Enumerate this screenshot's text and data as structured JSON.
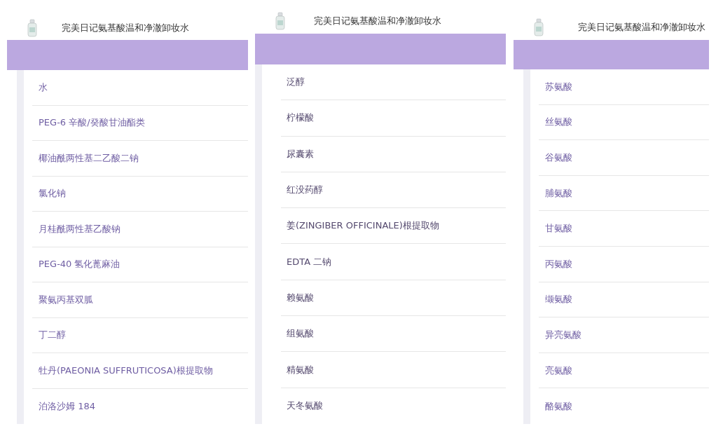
{
  "panels": [
    {
      "title": "完美日记氨基酸温和净澈卸妆水",
      "ingredients": [
        "水",
        "PEG-6 辛酸/癸酸甘油酯类",
        "椰油酰两性基二乙酸二钠",
        "氯化钠",
        "月桂酰两性基乙酸钠",
        "PEG-40 氢化蓖麻油",
        "聚氨丙基双胍",
        "丁二醇",
        "牡丹(PAEONIA SUFFRUTICOSA)根提取物",
        "泊洛沙姆 184"
      ]
    },
    {
      "title": "完美日记氨基酸温和净澈卸妆水",
      "ingredients": [
        "泛醇",
        "柠檬酸",
        "尿囊素",
        "红没药醇",
        "姜(ZINGIBER OFFICINALE)根提取物",
        "EDTA 二钠",
        "赖氨酸",
        "组氨酸",
        "精氨酸",
        "天冬氨酸"
      ]
    },
    {
      "title": "完美日记氨基酸温和净澈卸妆水",
      "ingredients": [
        "苏氨酸",
        "丝氨酸",
        "谷氨酸",
        "脯氨酸",
        "甘氨酸",
        "丙氨酸",
        "缬氨酸",
        "异亮氨酸",
        "亮氨酸",
        "酪氨酸"
      ]
    }
  ]
}
